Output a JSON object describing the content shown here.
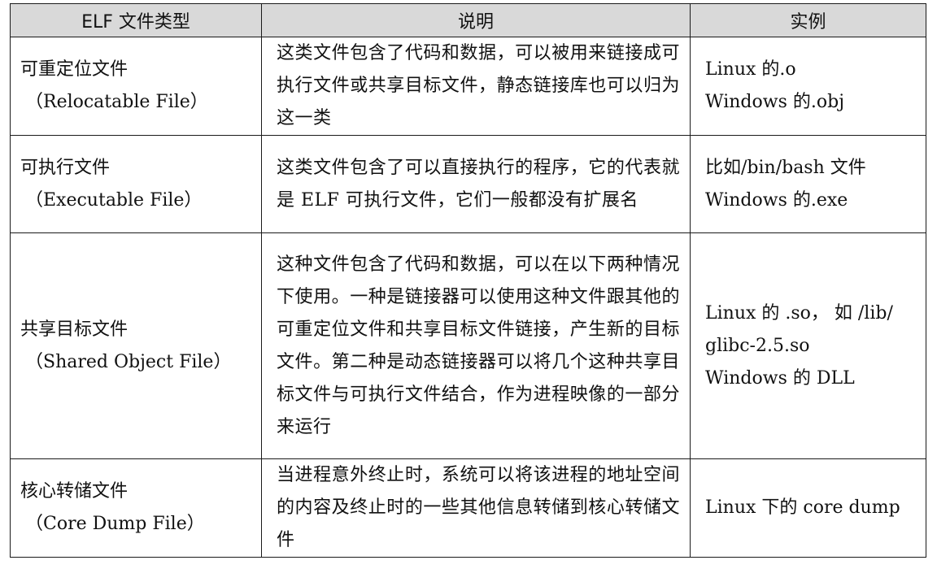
{
  "table": {
    "headers": [
      "ELF 文件类型",
      "说明",
      "实例"
    ],
    "rows": [
      {
        "type_cn": "可重定位文件",
        "type_en": "（Relocatable File）",
        "description": "这类文件包含了代码和数据，可以被用来链接成可执行文件或共享目标文件，静态链接库也可以归为这一类",
        "examples": [
          "Linux 的.o",
          "Windows 的.obj"
        ]
      },
      {
        "type_cn": "可执行文件",
        "type_en": "（Executable File）",
        "description": "这类文件包含了可以直接执行的程序，它的代表就是 ELF 可执行文件，它们一般都没有扩展名",
        "examples": [
          "比如/bin/bash 文件",
          "Windows 的.exe"
        ]
      },
      {
        "type_cn": "共享目标文件",
        "type_en": "（Shared Object File）",
        "description": "这种文件包含了代码和数据，可以在以下两种情况下使用。一种是链接器可以使用这种文件跟其他的可重定位文件和共享目标文件链接，产生新的目标文件。第二种是动态链接器可以将几个这种共享目标文件与可执行文件结合，作为进程映像的一部分来运行",
        "examples": [
          "Linux 的 .so， 如 /lib/",
          "glibc-2.5.so",
          "Windows 的 DLL"
        ]
      },
      {
        "type_cn": "核心转储文件",
        "type_en": "（Core Dump File）",
        "description": "当进程意外终止时，系统可以将该进程的地址空间的内容及终止时的一些其他信息转储到核心转储文件",
        "examples": [
          "Linux 下的 core dump"
        ]
      }
    ]
  }
}
